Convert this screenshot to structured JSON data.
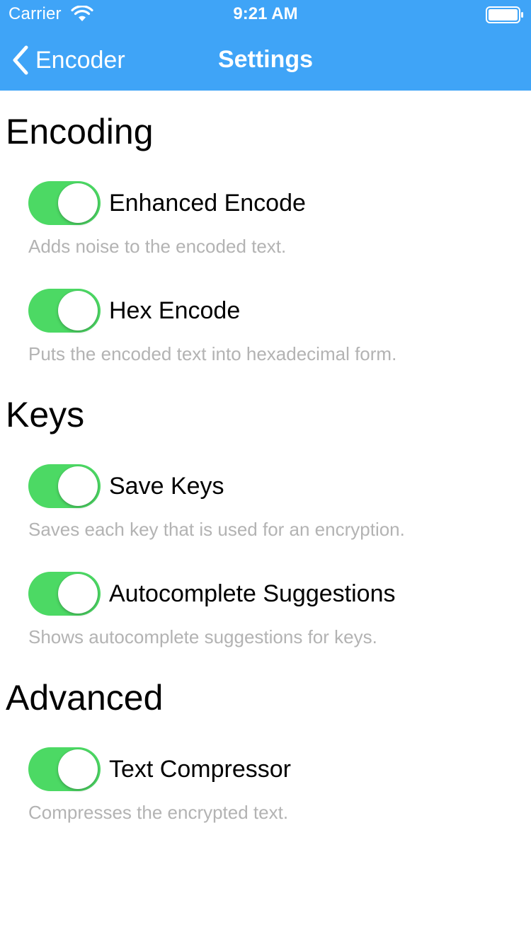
{
  "status_bar": {
    "carrier": "Carrier",
    "time": "9:21 AM",
    "wifi_icon": "wifi-icon",
    "battery_icon": "battery-icon"
  },
  "nav_bar": {
    "back_label": "Encoder",
    "back_icon": "chevron-left-icon",
    "title": "Settings",
    "background_color": "#3fa4f7"
  },
  "sections": [
    {
      "title": "Encoding",
      "settings": [
        {
          "label": "Enhanced Encode",
          "description": "Adds noise to the encoded text.",
          "enabled": true
        },
        {
          "label": "Hex Encode",
          "description": "Puts the encoded text into hexadecimal form.",
          "enabled": true
        }
      ]
    },
    {
      "title": "Keys",
      "settings": [
        {
          "label": "Save Keys",
          "description": "Saves each key that is used for an encryption.",
          "enabled": true
        },
        {
          "label": "Autocomplete Suggestions",
          "description": "Shows autocomplete suggestions for keys.",
          "enabled": true
        }
      ]
    },
    {
      "title": "Advanced",
      "settings": [
        {
          "label": "Text Compressor",
          "description": "Compresses the encrypted text.",
          "enabled": true
        }
      ]
    }
  ],
  "colors": {
    "toggle_on": "#4cd964",
    "description_text": "#b3b3b3"
  }
}
